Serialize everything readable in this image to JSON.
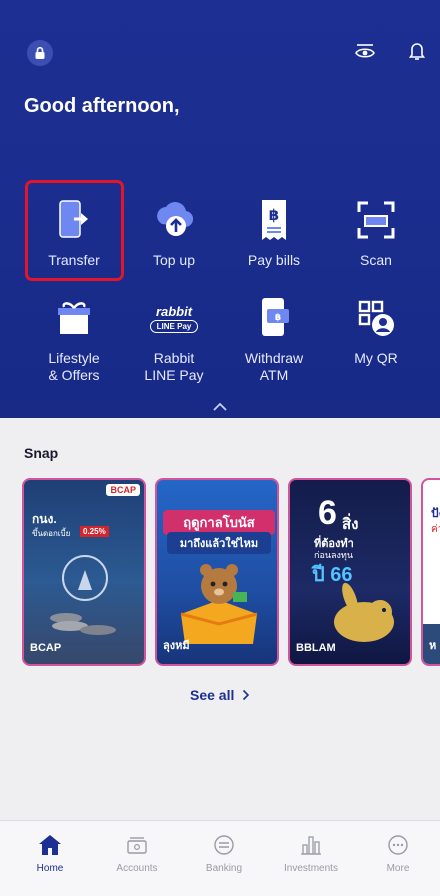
{
  "header": {
    "greeting": "Good afternoon,"
  },
  "quick_actions": [
    {
      "label": "Transfer",
      "icon": "transfer-icon"
    },
    {
      "label": "Top up",
      "icon": "top-up-icon"
    },
    {
      "label": "Pay bills",
      "icon": "pay-bills-icon"
    },
    {
      "label": "Scan",
      "icon": "scan-icon"
    },
    {
      "label": "Lifestyle\n& Offers",
      "icon": "gift-icon"
    },
    {
      "label": "Rabbit\nLINE Pay",
      "icon": "rabbit-line-pay-icon"
    },
    {
      "label": "Withdraw\nATM",
      "icon": "withdraw-atm-icon"
    },
    {
      "label": "My QR",
      "icon": "my-qr-icon"
    }
  ],
  "rabbit_logo": {
    "line1": "rabbit",
    "line2": "LINE Pay"
  },
  "snap": {
    "title": "Snap",
    "see_all": "See all",
    "cards": [
      {
        "caption": "BCAP",
        "brand": "BCAP",
        "headline": "กนง.",
        "sub": "ขึ้นดอกเบี้ย",
        "rate": "0.25%"
      },
      {
        "caption": "ลุงหมี",
        "headline": "ฤดูกาลโบนัส",
        "sub": "มาถึงแล้วใช่ไหม"
      },
      {
        "caption": "BBLAM",
        "headline": "6",
        "sub1": "สิ่ง",
        "sub2": "ที่ต้องทำ",
        "sub3": "ก่อนลงทุน",
        "year": "ปี 66"
      },
      {
        "caption": "ห",
        "headline": "ปัง",
        "sub": "ค่า"
      }
    ]
  },
  "nav": [
    {
      "label": "Home",
      "icon": "home-icon",
      "active": true
    },
    {
      "label": "Accounts",
      "icon": "accounts-icon"
    },
    {
      "label": "Banking",
      "icon": "banking-icon"
    },
    {
      "label": "Investments",
      "icon": "investments-icon"
    },
    {
      "label": "More",
      "icon": "more-icon"
    }
  ],
  "colors": {
    "primary": "#1d2f92",
    "highlight": "#e3152b",
    "card_border": "#d2559b"
  }
}
